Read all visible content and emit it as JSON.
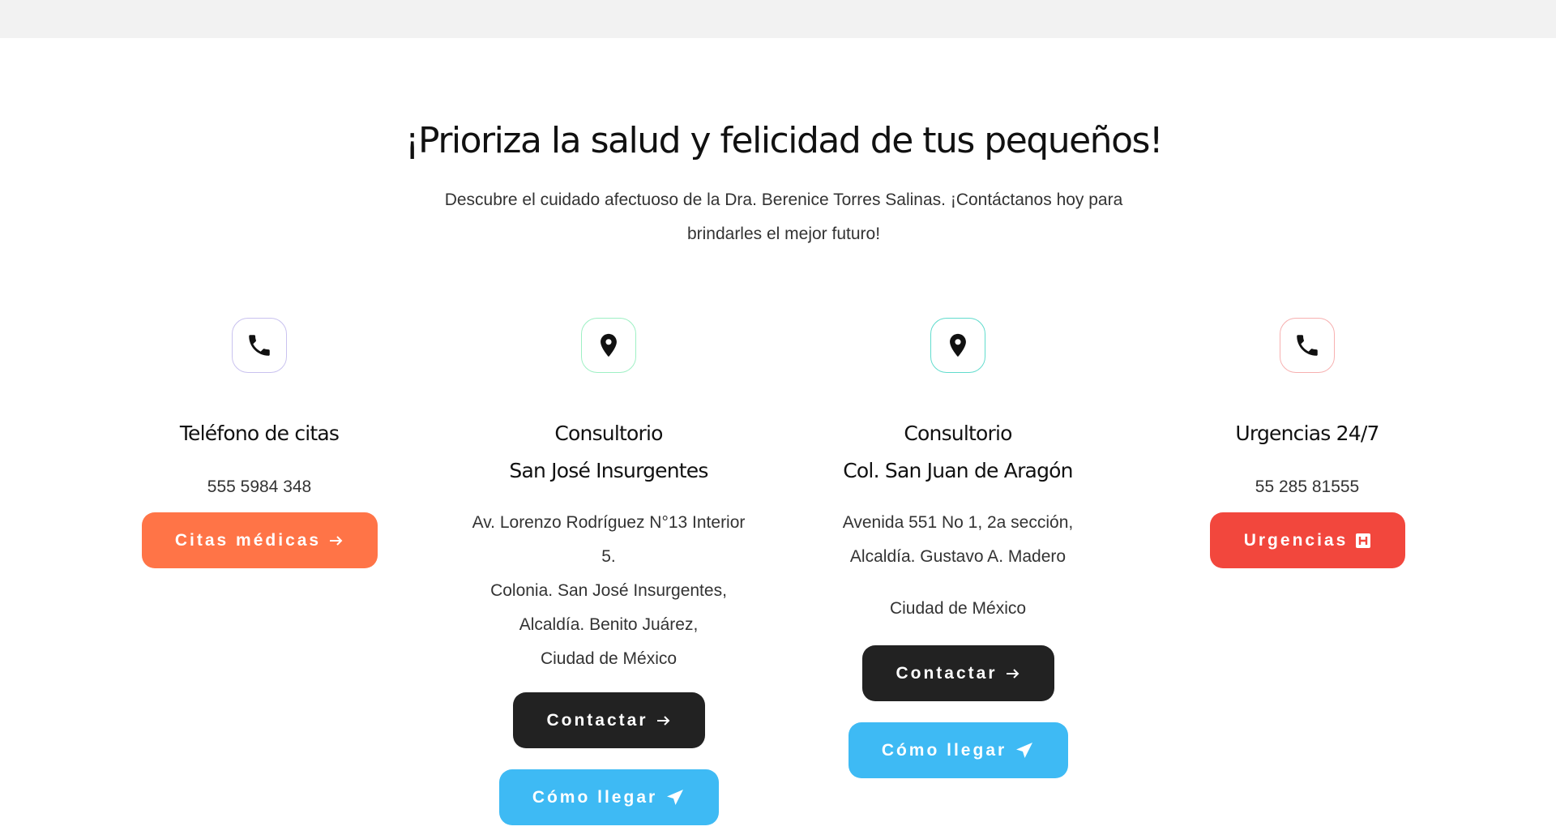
{
  "heading": "¡Prioriza la salud y felicidad de tus pequeños!",
  "subheading_line1": "Descubre el cuidado afectuoso de la Dra. Berenice Torres Salinas. ¡Contáctanos hoy para",
  "subheading_line2": "brindarles el mejor futuro!",
  "columns": [
    {
      "icon": "phone-icon",
      "title_lines": [
        "Teléfono de citas"
      ],
      "info_lines": [
        "555 5984 348"
      ],
      "buttons": [
        {
          "label": "Citas médicas",
          "icon": "arrow-right-icon",
          "color": "#ff7447"
        }
      ]
    },
    {
      "icon": "location-pin-icon",
      "title_lines": [
        "Consultorio",
        "San José Insurgentes"
      ],
      "info_lines": [
        "Av. Lorenzo Rodríguez N°13 Interior",
        "5.",
        "Colonia. San José Insurgentes,",
        "Alcaldía. Benito Juárez,",
        "Ciudad de México"
      ],
      "buttons": [
        {
          "label": "Contactar",
          "icon": "arrow-right-icon",
          "color": "#222222"
        },
        {
          "label": "Cómo llegar",
          "icon": "paper-plane-icon",
          "color": "#3ebaf4"
        }
      ]
    },
    {
      "icon": "location-pin-icon",
      "title_lines": [
        "Consultorio",
        "Col. San Juan de Aragón"
      ],
      "info_lines": [
        "Avenida 551 No 1, 2a sección,",
        "Alcaldía. Gustavo A. Madero"
      ],
      "info_lines_2": [
        "Ciudad de México"
      ],
      "buttons": [
        {
          "label": "Contactar",
          "icon": "arrow-right-icon",
          "color": "#222222"
        },
        {
          "label": "Cómo llegar",
          "icon": "paper-plane-icon",
          "color": "#3ebaf4"
        }
      ]
    },
    {
      "icon": "phone-icon",
      "title_lines": [
        "Urgencias 24/7"
      ],
      "info_lines": [
        "55 285 81555"
      ],
      "buttons": [
        {
          "label": "Urgencias",
          "icon": "hospital-h-icon",
          "color": "#f2473d"
        }
      ]
    }
  ]
}
